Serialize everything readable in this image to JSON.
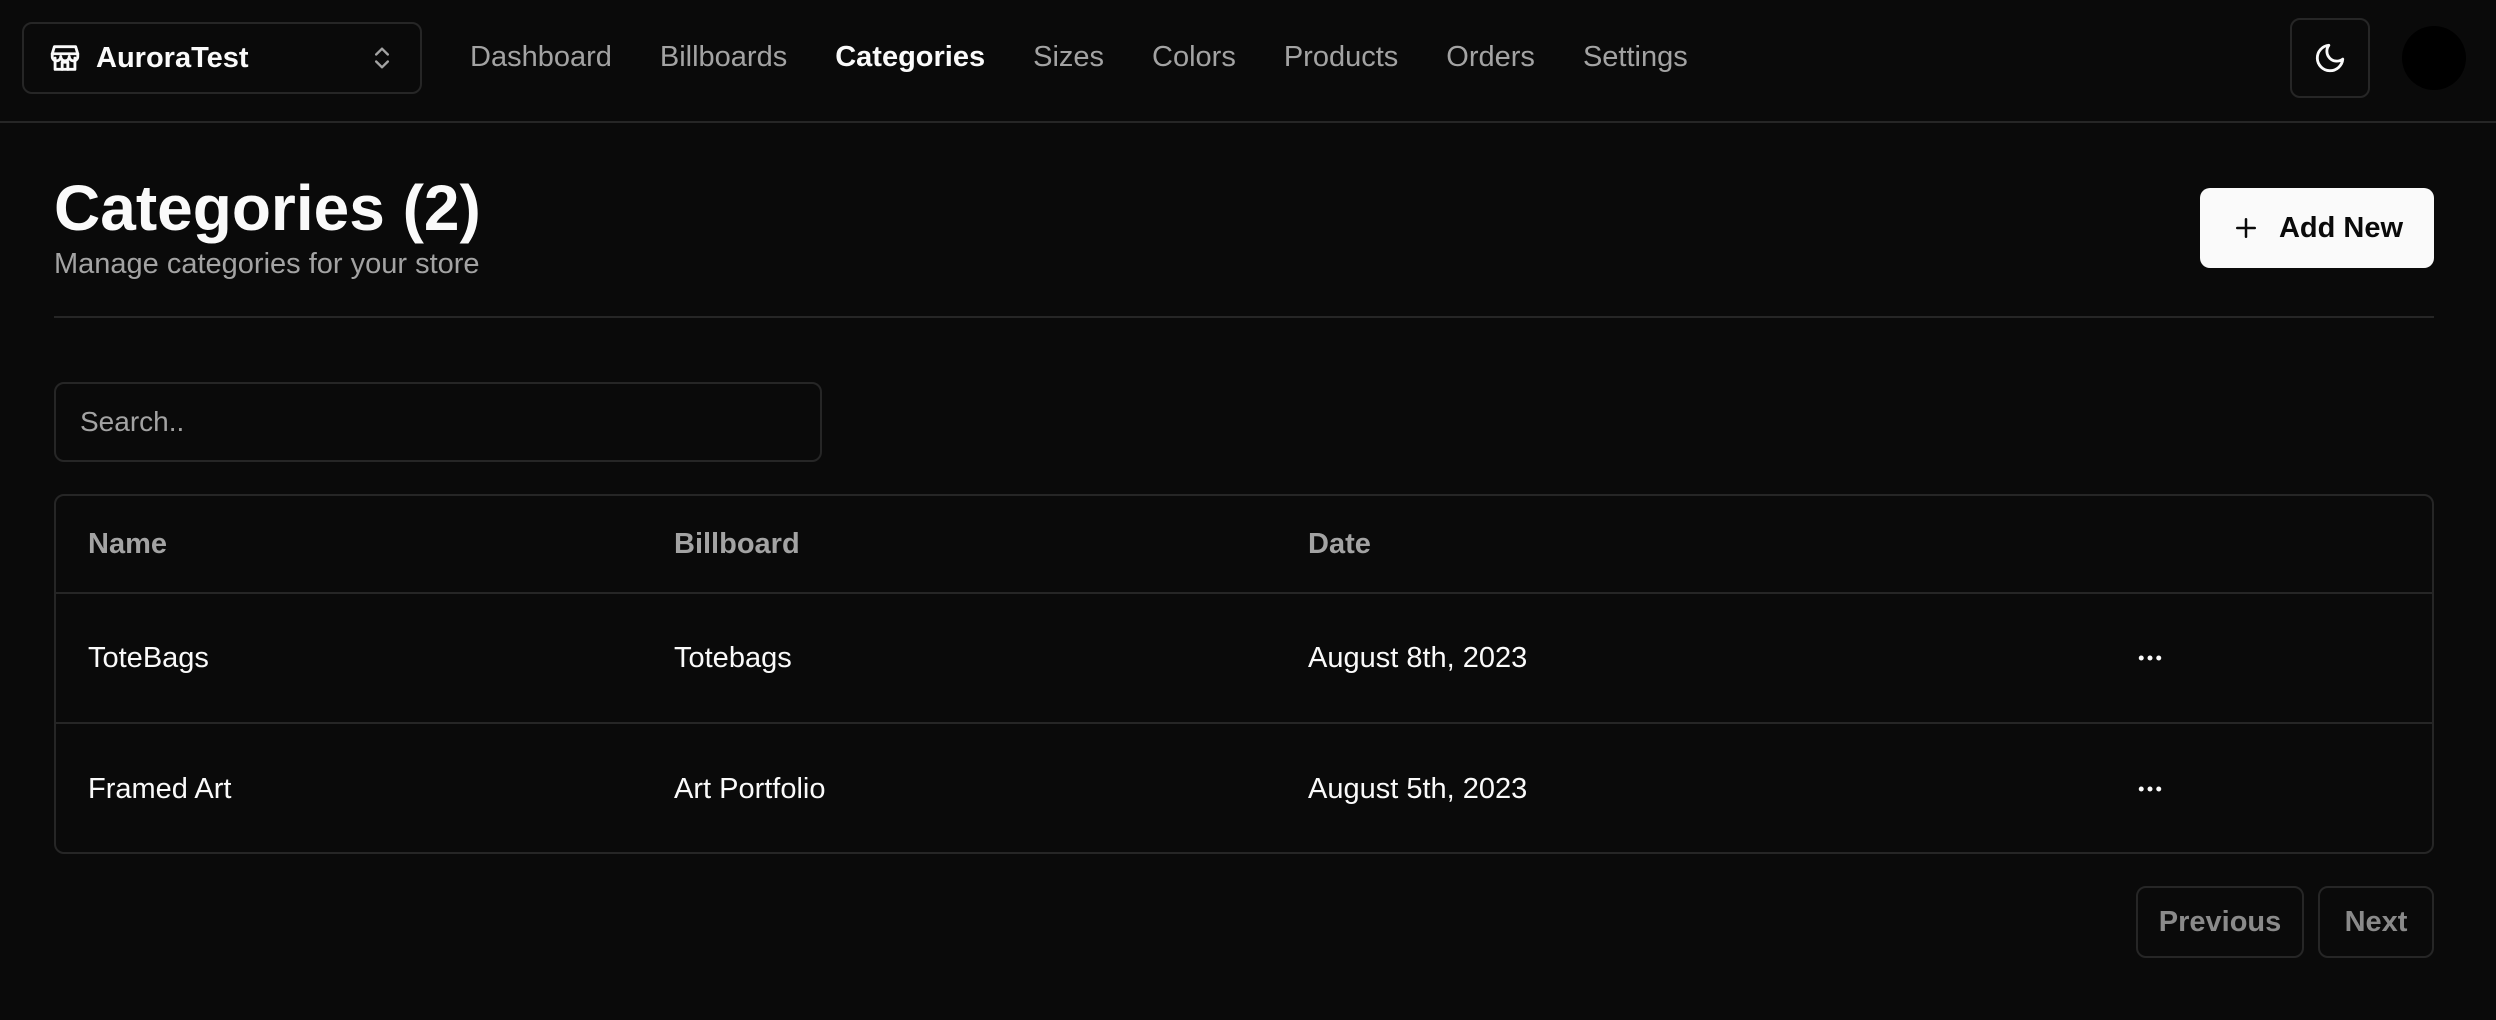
{
  "navbar": {
    "store_name": "AuroraTest",
    "links": [
      {
        "label": "Dashboard",
        "active": false
      },
      {
        "label": "Billboards",
        "active": false
      },
      {
        "label": "Categories",
        "active": true
      },
      {
        "label": "Sizes",
        "active": false
      },
      {
        "label": "Colors",
        "active": false
      },
      {
        "label": "Products",
        "active": false
      },
      {
        "label": "Orders",
        "active": false
      },
      {
        "label": "Settings",
        "active": false
      }
    ],
    "theme_icon": "moon-icon"
  },
  "header": {
    "title": "Categories (2)",
    "subtitle": "Manage categories for your store",
    "add_button_label": "Add New",
    "add_icon": "plus-icon"
  },
  "search": {
    "placeholder": "Search..",
    "value": ""
  },
  "table": {
    "columns": [
      "Name",
      "Billboard",
      "Date"
    ],
    "rows": [
      {
        "name": "ToteBags",
        "billboard": "Totebags",
        "date": "August 8th, 2023",
        "action_icon": "more-horizontal-icon"
      },
      {
        "name": "Framed Art",
        "billboard": "Art Portfolio",
        "date": "August 5th, 2023",
        "action_icon": "more-horizontal-icon"
      }
    ]
  },
  "pagination": {
    "previous_label": "Previous",
    "next_label": "Next"
  },
  "colors": {
    "background": "#0a0a0a",
    "border": "#262626",
    "foreground": "#fafafa",
    "muted": "#a3a3a3"
  }
}
